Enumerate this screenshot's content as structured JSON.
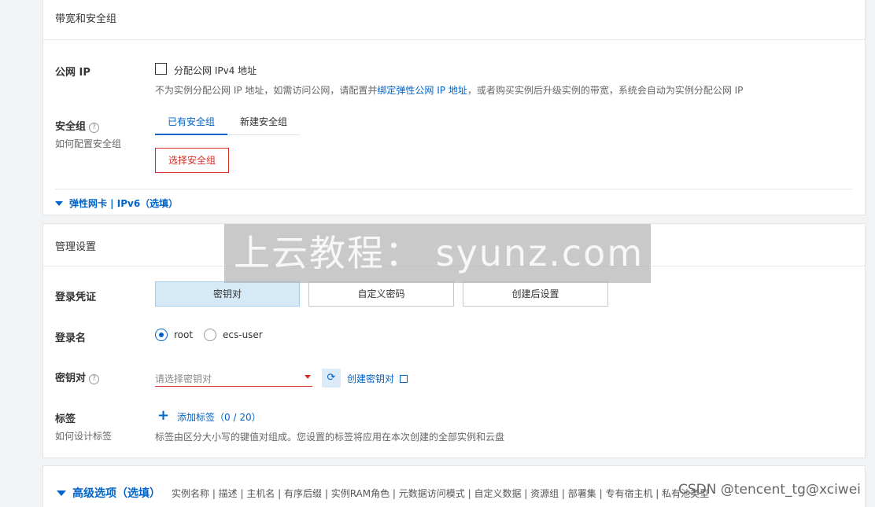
{
  "bandwidth_section": {
    "title": "带宽和安全组",
    "public_ip": {
      "label": "公网 IP",
      "checkbox_label": "分配公网 IPv4 地址",
      "hint_prefix": "不为实例分配公网 IP 地址，如需访问公网，请配置并",
      "hint_link": "绑定弹性公网 IP 地址",
      "hint_suffix": "，或者购买实例后升级实例的带宽，系统会自动为实例分配公网 IP"
    },
    "security_group": {
      "label": "安全组",
      "sub_label": "如何配置安全组",
      "tabs": [
        "已有安全组",
        "新建安全组"
      ],
      "select_button": "选择安全组"
    },
    "eni_toggle": "弹性网卡 | IPv6（选填）"
  },
  "management_section": {
    "title": "管理设置",
    "login_credential": {
      "label": "登录凭证",
      "options": [
        "密钥对",
        "自定义密码",
        "创建后设置"
      ],
      "selected": "密钥对"
    },
    "login_name": {
      "label": "登录名",
      "options": [
        "root",
        "ecs-user"
      ],
      "selected": "root"
    },
    "key_pair": {
      "label": "密钥对",
      "placeholder": "请选择密钥对",
      "create_link": "创建密钥对"
    },
    "tags": {
      "label": "标签",
      "sub_label": "如何设计标签",
      "add_link": "添加标签",
      "count": "（0 / 20）",
      "hint": "标签由区分大小写的键值对组成。您设置的标签将应用在本次创建的全部实例和云盘"
    }
  },
  "advanced_section": {
    "title": "高级选项（选填）",
    "items": "实例名称 | 描述 | 主机名 | 有序后缀 | 实例RAM角色 | 元数据访问模式 | 自定义数据 | 资源组 | 部署集 | 专有宿主机 | 私有池类型"
  },
  "watermark": "上云教程： syunz.com",
  "csdn_watermark": "CSDN @tencent_tg@xciwei",
  "colors": {
    "accent": "#0064c8",
    "danger": "#d93026",
    "background": "#f2f3f5"
  }
}
